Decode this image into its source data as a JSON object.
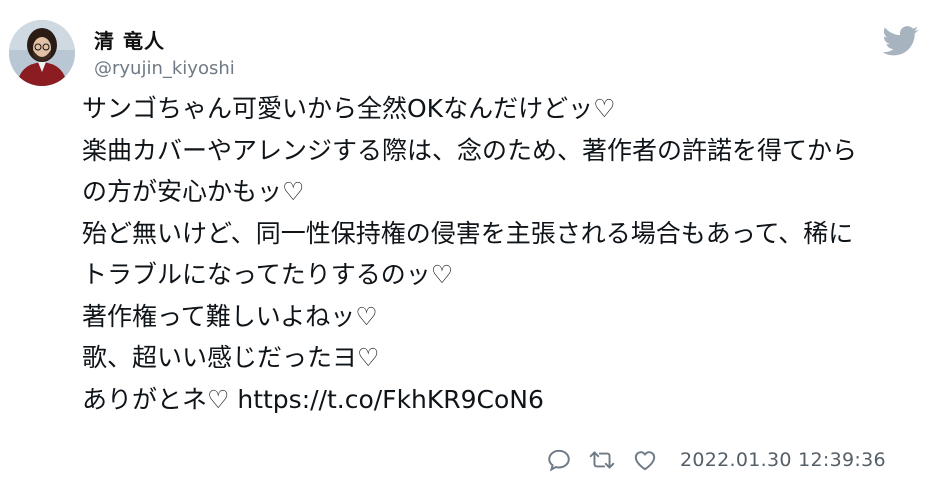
{
  "author": {
    "name": "清 竜人",
    "handle": "@ryujin_kiyoshi",
    "avatar_icon": "avatar-photo"
  },
  "logo_icon": "twitter-bird-icon",
  "accent_color": "#1da1f2",
  "tweet": {
    "lines": [
      "サンゴちゃん可愛いから全然OKなんだけどッ♡",
      "楽曲カバーやアレンジする際は、念のため、著作者の許諾を得てから",
      "の方が安心かもッ♡",
      "殆ど無いけど、同一性保持権の侵害を主張される場合もあって、稀に",
      "トラブルになってたりするのッ♡",
      "著作権って難しいよねッ♡",
      "歌、超いい感じだったヨ♡"
    ],
    "last_line_text": "ありがとネ♡ ",
    "link": "https://t.co/FkhKR9CoN6"
  },
  "footer": {
    "actions": [
      {
        "icon": "reply-icon"
      },
      {
        "icon": "retweet-icon"
      },
      {
        "icon": "like-heart-icon"
      }
    ],
    "timestamp": "2022.01.30 12:39:36"
  }
}
